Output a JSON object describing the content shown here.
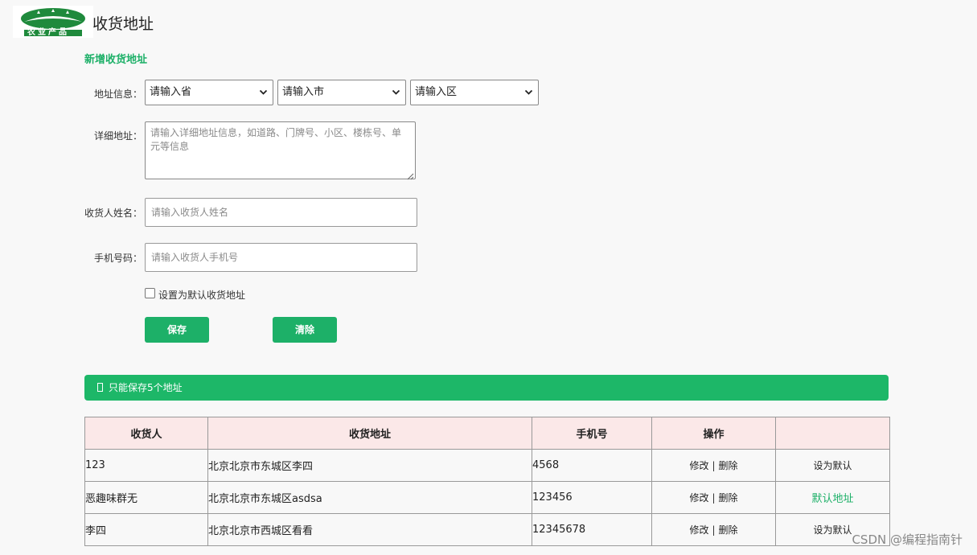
{
  "header": {
    "logo_text": "农业产品",
    "title": "收货地址"
  },
  "form": {
    "section_title": "新增收货地址",
    "address_label": "地址信息：",
    "province_value": "请输入省",
    "city_value": "请输入市",
    "district_value": "请输入区",
    "detail_label": "详细地址：",
    "detail_placeholder": "请输入详细地址信息，如道路、门牌号、小区、楼栋号、单元等信息",
    "name_label": "收货人姓名：",
    "name_placeholder": "请输入收货人姓名",
    "phone_label": "手机号码：",
    "phone_placeholder": "请输入收货人手机号",
    "default_checkbox_label": "设置为默认收货地址",
    "default_checked": false,
    "save_label": "保存",
    "clear_label": "清除"
  },
  "banner": {
    "text": "只能保存5个地址"
  },
  "table": {
    "headers": [
      "收货人",
      "收货地址",
      "手机号",
      "操作",
      ""
    ],
    "edit_label": "修改",
    "delete_label": "删除",
    "rows": [
      {
        "name": "123",
        "address": "北京北京市东城区李四",
        "phone": "4568",
        "default_action": "设为默认",
        "is_default": false
      },
      {
        "name": "恶趣味群无",
        "address": "北京北京市东城区asdsa",
        "phone": "123456",
        "default_action": "默认地址",
        "is_default": true
      },
      {
        "name": "李四",
        "address": "北京北京市西城区看看",
        "phone": "12345678",
        "default_action": "设为默认",
        "is_default": false
      }
    ]
  },
  "watermark": "CSDN @编程指南针",
  "colors": {
    "accent": "#1db068",
    "header_row_bg": "#fbe8e8",
    "page_bg": "#f8f8f8"
  }
}
